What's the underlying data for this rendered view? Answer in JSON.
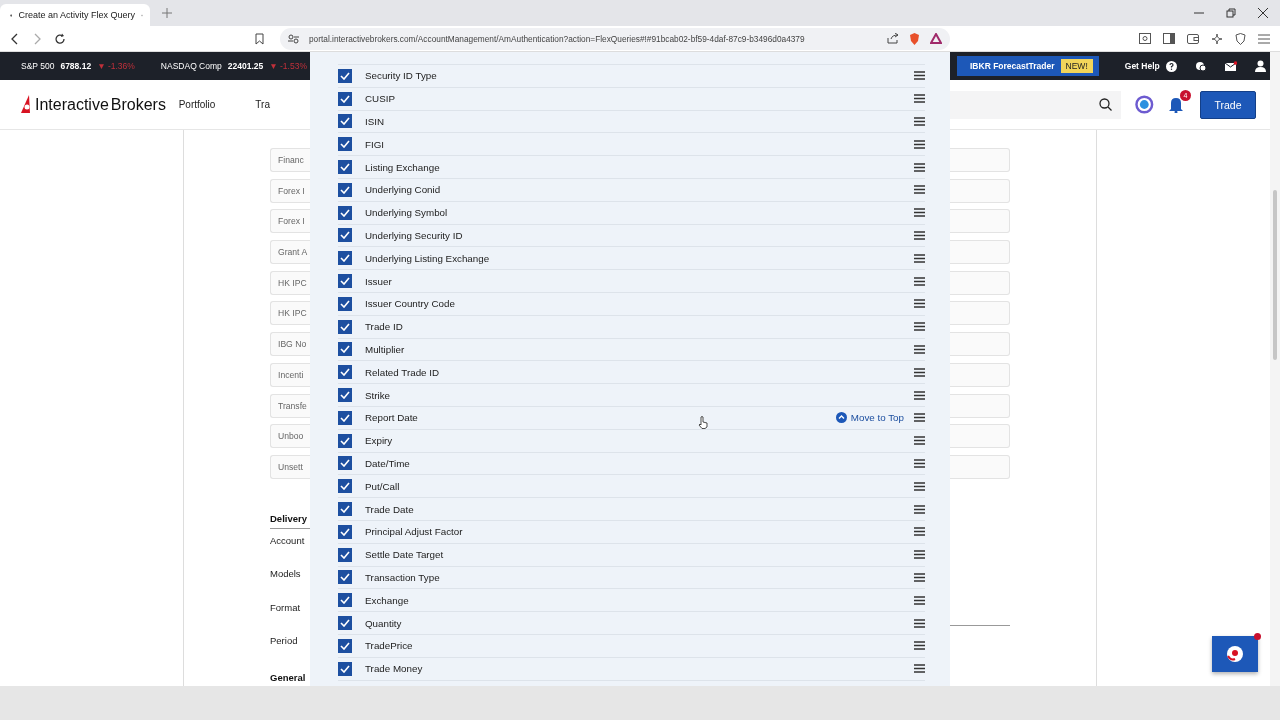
{
  "browser": {
    "tab_title": "Create an Activity Flex Query",
    "url": "portal.interactivebrokers.com/AccountManagement/AmAuthentication?action=FlexQueries#!#91bcab02-bf59-4daf-87c9-b3496d0a4379"
  },
  "ticker": [
    {
      "name": "S&P 500",
      "value": "6788.12",
      "change": "▼ -1.36%"
    },
    {
      "name": "NASDAQ Comp",
      "value": "22401.25",
      "change": "▼ -1.53%"
    }
  ],
  "promo": {
    "label": "IBKR ForecastTrader",
    "badge": "NEW!"
  },
  "help": "Get Help",
  "logo": {
    "light": "Interactive",
    "bold": "Brokers"
  },
  "nav": [
    "Portfolio",
    "Tra"
  ],
  "notifications": "4",
  "trade_button": "Trade",
  "sections": [
    "Financ",
    "Forex I",
    "Forex I",
    "Grant A",
    "HK IPC",
    "HK IPC",
    "IBG No",
    "Incenti",
    "Transfe",
    "Unboo",
    "Unsett"
  ],
  "delivery": {
    "title": "Delivery",
    "fields": [
      "Account",
      "Models",
      "Format",
      "Period"
    ]
  },
  "general": "General",
  "fields": [
    {
      "label": "Security ID Type",
      "checked": true
    },
    {
      "label": "CUSIP",
      "checked": true
    },
    {
      "label": "ISIN",
      "checked": true
    },
    {
      "label": "FIGI",
      "checked": true
    },
    {
      "label": "Listing Exchange",
      "checked": true
    },
    {
      "label": "Underlying Conid",
      "checked": true
    },
    {
      "label": "Underlying Symbol",
      "checked": true
    },
    {
      "label": "Underlying Security ID",
      "checked": true
    },
    {
      "label": "Underlying Listing Exchange",
      "checked": true
    },
    {
      "label": "Issuer",
      "checked": true
    },
    {
      "label": "Issuer Country Code",
      "checked": true
    },
    {
      "label": "Trade ID",
      "checked": true
    },
    {
      "label": "Multiplier",
      "checked": true
    },
    {
      "label": "Related Trade ID",
      "checked": true
    },
    {
      "label": "Strike",
      "checked": true
    },
    {
      "label": "Report Date",
      "checked": true,
      "action": "Move to Top"
    },
    {
      "label": "Expiry",
      "checked": true
    },
    {
      "label": "Date/Time",
      "checked": true
    },
    {
      "label": "Put/Call",
      "checked": true
    },
    {
      "label": "Trade Date",
      "checked": true
    },
    {
      "label": "Principal Adjust Factor",
      "checked": true
    },
    {
      "label": "Settle Date Target",
      "checked": true
    },
    {
      "label": "Transaction Type",
      "checked": true
    },
    {
      "label": "Exchange",
      "checked": true
    },
    {
      "label": "Quantity",
      "checked": true
    },
    {
      "label": "TradePrice",
      "checked": true
    },
    {
      "label": "Trade Money",
      "checked": true
    }
  ]
}
